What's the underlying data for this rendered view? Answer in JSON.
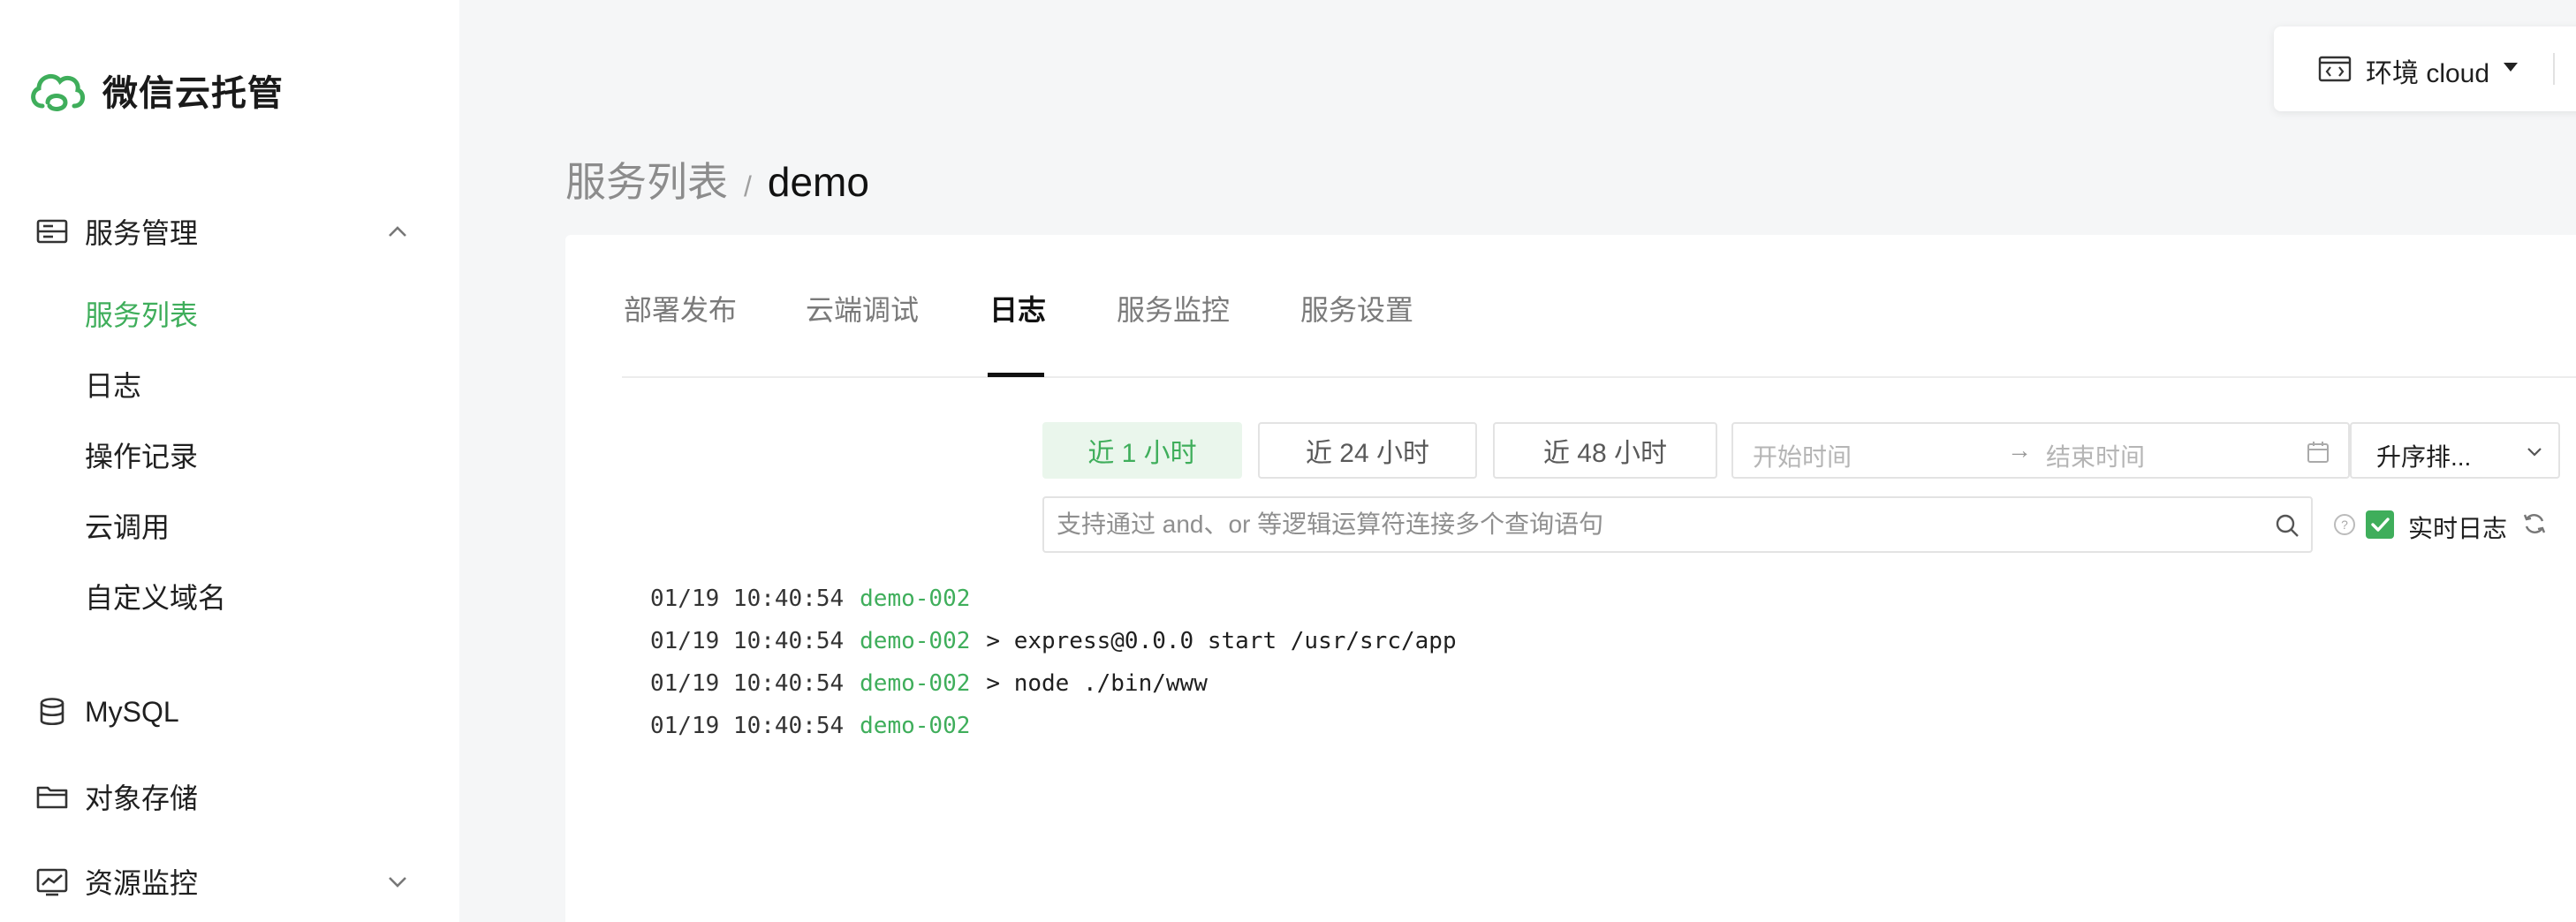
{
  "brand": {
    "name": "微信云托管"
  },
  "env": {
    "label": "环境 cloud"
  },
  "sidebar": {
    "service_mgmt": {
      "label": "服务管理"
    },
    "sub_items": [
      {
        "label": "服务列表",
        "active": true
      },
      {
        "label": "日志"
      },
      {
        "label": "操作记录"
      },
      {
        "label": "云调用"
      },
      {
        "label": "自定义域名"
      }
    ],
    "mysql": {
      "label": "MySQL"
    },
    "storage": {
      "label": "对象存储"
    },
    "monitor": {
      "label": "资源监控"
    }
  },
  "breadcrumb": {
    "parent": "服务列表",
    "separator": "/",
    "current": "demo"
  },
  "tabs": [
    {
      "label": "部署发布"
    },
    {
      "label": "云端调试"
    },
    {
      "label": "日志",
      "active": true
    },
    {
      "label": "服务监控"
    },
    {
      "label": "服务设置"
    }
  ],
  "filters": {
    "ranges": [
      {
        "label": "近 1 小时",
        "active": true
      },
      {
        "label": "近 24 小时"
      },
      {
        "label": "近 48 小时"
      }
    ],
    "start_placeholder": "开始时间",
    "arrow": "→",
    "end_placeholder": "结束时间",
    "sort_label": "升序排..."
  },
  "search": {
    "placeholder": "支持通过 and、or 等逻辑运算符连接多个查询语句",
    "realtime_label": "实时日志",
    "realtime_checked": true
  },
  "logs": [
    {
      "time": "01/19 10:40:54",
      "service": "demo-002",
      "message": ""
    },
    {
      "time": "01/19 10:40:54",
      "service": "demo-002",
      "message": "> express@0.0.0 start /usr/src/app"
    },
    {
      "time": "01/19 10:40:54",
      "service": "demo-002",
      "message": "> node ./bin/www"
    },
    {
      "time": "01/19 10:40:54",
      "service": "demo-002",
      "message": ""
    }
  ],
  "colors": {
    "accent": "#3fae5b",
    "accent_light": "#eaf6ec",
    "background": "#f5f6f7"
  }
}
